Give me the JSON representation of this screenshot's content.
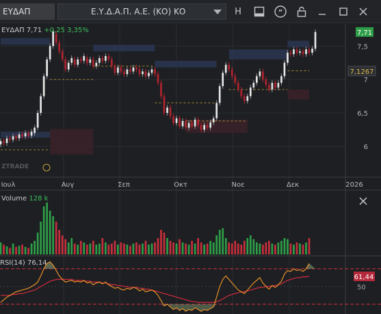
{
  "toolbar": {
    "symbol": "ΕΥΔΑΠ",
    "instrument": "Ε.Υ.Δ.Α.Π. Α.Ε. (ΚΟ) ΚΟ",
    "h_label": "H"
  },
  "price_panel": {
    "legend_symbol": "ΕΥΔΑΠ",
    "legend_price": "7,71",
    "legend_change": "+0,25",
    "legend_change_pct": "3,35%",
    "last_price_label": "7,71",
    "ref_price_label": "7,1267",
    "y_axis_ticks": [
      "7,5",
      "7",
      "6,5",
      "6"
    ],
    "watermark": "ZTRADE",
    "x_axis_labels": [
      "Ιουλ",
      "Αυγ",
      "Σεπ",
      "Οκτ",
      "Νοε",
      "Δεκ",
      "2026"
    ]
  },
  "volume_panel": {
    "title": "Volume",
    "value": "128 k",
    "last_label": "128 k"
  },
  "rsi_panel": {
    "title": "RSI(14)",
    "value": "76,14",
    "label_rsi": "76,14",
    "label_ma": "61,44",
    "tick_50": "50"
  },
  "chart_data": {
    "type": "candlestick",
    "title": "ΕΥΔΑΠ",
    "x_axis_labels": [
      "Ιουλ",
      "Αυγ",
      "Σεπ",
      "Οκτ",
      "Νοε",
      "Δεκ",
      "2026"
    ],
    "y_ticks": [
      7.5,
      7,
      6.5,
      6
    ],
    "ylim": [
      5.55,
      7.82
    ],
    "last": 7.71,
    "reference_level": 7.1267,
    "candles": [
      {
        "o": 6.03,
        "c": 6.08
      },
      {
        "o": 6.08,
        "c": 6.05
      },
      {
        "o": 6.05,
        "c": 6.12
      },
      {
        "o": 6.12,
        "c": 6.1
      },
      {
        "o": 6.1,
        "c": 6.15
      },
      {
        "o": 6.15,
        "c": 6.12
      },
      {
        "o": 6.12,
        "c": 6.18
      },
      {
        "o": 6.18,
        "c": 6.15
      },
      {
        "o": 6.15,
        "c": 6.2
      },
      {
        "o": 6.2,
        "c": 6.16
      },
      {
        "o": 6.16,
        "c": 6.22
      },
      {
        "o": 6.2,
        "c": 6.28
      },
      {
        "o": 6.28,
        "c": 6.5
      },
      {
        "o": 6.5,
        "c": 6.75
      },
      {
        "o": 6.75,
        "c": 7.05
      },
      {
        "o": 7.05,
        "c": 7.3
      },
      {
        "o": 7.3,
        "c": 7.5
      },
      {
        "o": 7.5,
        "c": 7.72
      },
      {
        "o": 7.68,
        "c": 7.55
      },
      {
        "o": 7.55,
        "c": 7.42
      },
      {
        "o": 7.42,
        "c": 7.3
      },
      {
        "o": 7.3,
        "c": 7.15
      },
      {
        "o": 7.15,
        "c": 7.25
      },
      {
        "o": 7.25,
        "c": 7.32
      },
      {
        "o": 7.3,
        "c": 7.22
      },
      {
        "o": 7.22,
        "c": 7.3
      },
      {
        "o": 7.3,
        "c": 7.28
      },
      {
        "o": 7.28,
        "c": 7.35
      },
      {
        "o": 7.32,
        "c": 7.25
      },
      {
        "o": 7.25,
        "c": 7.3
      },
      {
        "o": 7.3,
        "c": 7.2
      },
      {
        "o": 7.2,
        "c": 7.25
      },
      {
        "o": 7.25,
        "c": 7.32
      },
      {
        "o": 7.32,
        "c": 7.28
      },
      {
        "o": 7.28,
        "c": 7.35
      },
      {
        "o": 7.35,
        "c": 7.3
      },
      {
        "o": 7.3,
        "c": 7.2
      },
      {
        "o": 7.2,
        "c": 7.1
      },
      {
        "o": 7.1,
        "c": 7.18
      },
      {
        "o": 7.18,
        "c": 7.12
      },
      {
        "o": 7.12,
        "c": 7.08
      },
      {
        "o": 7.08,
        "c": 7.15
      },
      {
        "o": 7.15,
        "c": 7.12
      },
      {
        "o": 7.12,
        "c": 7.18
      },
      {
        "o": 7.18,
        "c": 7.15
      },
      {
        "o": 7.15,
        "c": 7.08
      },
      {
        "o": 7.08,
        "c": 7.12
      },
      {
        "o": 7.12,
        "c": 7.05
      },
      {
        "o": 7.05,
        "c": 7.1
      },
      {
        "o": 7.1,
        "c": 7.15
      },
      {
        "o": 7.15,
        "c": 7.08
      },
      {
        "o": 7.08,
        "c": 6.95
      },
      {
        "o": 6.95,
        "c": 6.75
      },
      {
        "o": 6.75,
        "c": 6.5
      },
      {
        "o": 6.5,
        "c": 6.58
      },
      {
        "o": 6.58,
        "c": 6.45
      },
      {
        "o": 6.45,
        "c": 6.35
      },
      {
        "o": 6.35,
        "c": 6.42
      },
      {
        "o": 6.42,
        "c": 6.3
      },
      {
        "o": 6.3,
        "c": 6.38
      },
      {
        "o": 6.38,
        "c": 6.28
      },
      {
        "o": 6.28,
        "c": 6.35
      },
      {
        "o": 6.35,
        "c": 6.3
      },
      {
        "o": 6.3,
        "c": 6.4
      },
      {
        "o": 6.4,
        "c": 6.32
      },
      {
        "o": 6.32,
        "c": 6.25
      },
      {
        "o": 6.25,
        "c": 6.32
      },
      {
        "o": 6.32,
        "c": 6.28
      },
      {
        "o": 6.28,
        "c": 6.36
      },
      {
        "o": 6.36,
        "c": 6.42
      },
      {
        "o": 6.42,
        "c": 6.65
      },
      {
        "o": 6.65,
        "c": 6.9
      },
      {
        "o": 6.9,
        "c": 7.1
      },
      {
        "o": 7.1,
        "c": 7.22
      },
      {
        "o": 7.22,
        "c": 7.15
      },
      {
        "o": 7.15,
        "c": 7.05
      },
      {
        "o": 7.05,
        "c": 6.95
      },
      {
        "o": 6.95,
        "c": 6.85
      },
      {
        "o": 6.85,
        "c": 6.75
      },
      {
        "o": 6.75,
        "c": 6.68
      },
      {
        "o": 6.68,
        "c": 6.75
      },
      {
        "o": 6.75,
        "c": 6.88
      },
      {
        "o": 6.88,
        "c": 6.95
      },
      {
        "o": 6.95,
        "c": 7.05
      },
      {
        "o": 7.05,
        "c": 7.12
      },
      {
        "o": 7.12,
        "c": 7.0
      },
      {
        "o": 7.0,
        "c": 6.92
      },
      {
        "o": 6.92,
        "c": 6.85
      },
      {
        "o": 6.85,
        "c": 6.95
      },
      {
        "o": 6.95,
        "c": 6.88
      },
      {
        "o": 6.88,
        "c": 6.95
      },
      {
        "o": 6.95,
        "c": 7.05
      },
      {
        "o": 7.05,
        "c": 7.25
      },
      {
        "o": 7.25,
        "c": 7.4
      },
      {
        "o": 7.4,
        "c": 7.38
      },
      {
        "o": 7.38,
        "c": 7.45
      },
      {
        "o": 7.45,
        "c": 7.4
      },
      {
        "o": 7.4,
        "c": 7.42
      },
      {
        "o": 7.42,
        "c": 7.38
      },
      {
        "o": 7.38,
        "c": 7.45
      },
      {
        "o": 7.45,
        "c": 7.4
      },
      {
        "o": 7.4,
        "c": 7.46
      },
      {
        "o": 7.46,
        "c": 7.71
      }
    ],
    "volume": [
      22,
      18,
      15,
      12,
      20,
      14,
      16,
      18,
      14,
      12,
      20,
      25,
      40,
      60,
      88,
      95,
      80,
      70,
      60,
      45,
      35,
      28,
      22,
      30,
      20,
      18,
      25,
      22,
      18,
      20,
      25,
      18,
      20,
      30,
      22,
      18,
      20,
      25,
      18,
      22,
      20,
      18,
      16,
      20,
      22,
      18,
      20,
      25,
      18,
      20,
      22,
      30,
      45,
      40,
      30,
      25,
      22,
      20,
      28,
      22,
      20,
      18,
      25,
      20,
      30,
      22,
      18,
      20,
      25,
      22,
      35,
      45,
      48,
      30,
      22,
      20,
      25,
      20,
      18,
      25,
      30,
      35,
      28,
      22,
      20,
      18,
      22,
      25,
      20,
      18,
      22,
      25,
      30,
      28,
      20,
      18,
      22,
      20,
      18,
      22,
      30
    ],
    "rsi": [
      32,
      35,
      38,
      40,
      42,
      44,
      45,
      46,
      47,
      48,
      50,
      52,
      55,
      62,
      70,
      76,
      78,
      74,
      68,
      62,
      58,
      55,
      56,
      57,
      55,
      56,
      55,
      57,
      54,
      55,
      52,
      54,
      55,
      53,
      55,
      52,
      50,
      48,
      49,
      47,
      46,
      48,
      47,
      49,
      48,
      45,
      47,
      44,
      45,
      46,
      44,
      40,
      34,
      28,
      30,
      27,
      24,
      26,
      23,
      25,
      22,
      24,
      23,
      26,
      24,
      22,
      24,
      23,
      25,
      27,
      38,
      50,
      58,
      62,
      58,
      54,
      50,
      46,
      44,
      42,
      46,
      50,
      54,
      57,
      60,
      54,
      50,
      47,
      51,
      49,
      52,
      56,
      64,
      68,
      67,
      70,
      68,
      69,
      67,
      70,
      76
    ],
    "rsi_ma": [
      40,
      40,
      40,
      40,
      41,
      41,
      42,
      42,
      43,
      44,
      45,
      46,
      48,
      50,
      52,
      54,
      56,
      57,
      58,
      58,
      58,
      58,
      58,
      58,
      57,
      57,
      57,
      56,
      56,
      56,
      55,
      55,
      55,
      54,
      54,
      53,
      52,
      52,
      51,
      51,
      50,
      50,
      49,
      49,
      49,
      48,
      48,
      47,
      47,
      46,
      45,
      44,
      43,
      42,
      41,
      40,
      39,
      38,
      37,
      36,
      35,
      34,
      33,
      33,
      32,
      32,
      32,
      32,
      32,
      32,
      33,
      34,
      36,
      38,
      40,
      41,
      42,
      43,
      44,
      44,
      45,
      46,
      47,
      48,
      49,
      49,
      50,
      50,
      51,
      51,
      52,
      53,
      55,
      57,
      58,
      59,
      60,
      60,
      61,
      61,
      61.44
    ],
    "rsi_levels": [
      70,
      30,
      50
    ]
  },
  "colors": {
    "background": "#1d1f22",
    "up": "#2e9e48",
    "down": "#c62f3c",
    "candle_up": "#e6e6e6",
    "candle_down": "#b0232f",
    "rsi_line": "#e8902a",
    "rsi_ma": "#c42b3e",
    "rsi_level": "#d93040",
    "last_price": "#2e9e48",
    "ref_price": "#2c2f33",
    "zone_blue": "#2a3650",
    "zone_red": "#3a2228",
    "zone_line": "#c9a23a"
  }
}
